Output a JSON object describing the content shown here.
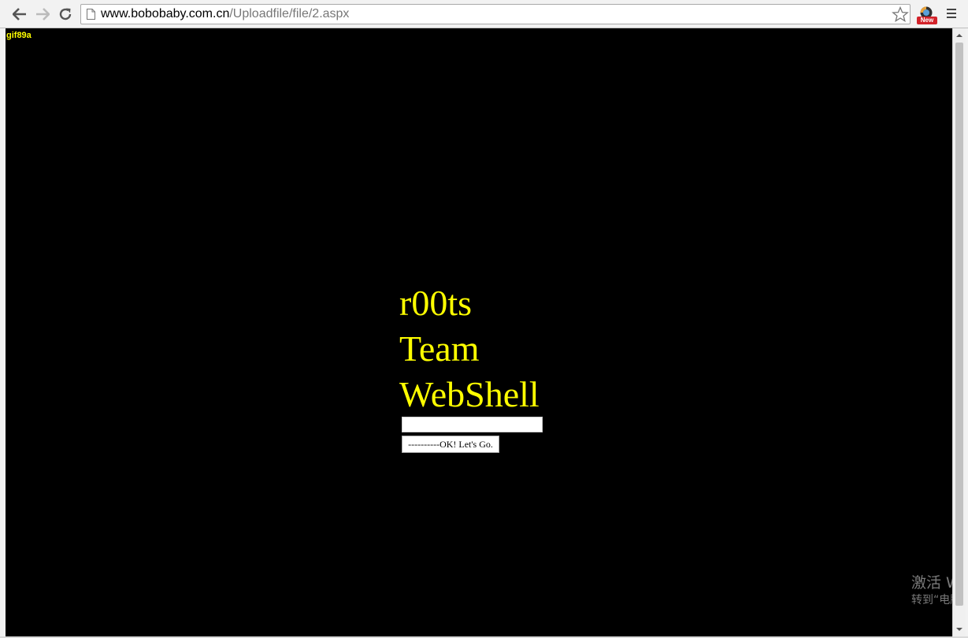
{
  "browser": {
    "url_host": "www.bobobaby.com.cn",
    "url_path": "/Uploadfile/file/2.aspx",
    "ext_badge": "New"
  },
  "page": {
    "gif_text": "gif89a",
    "title_lines": [
      "r00ts",
      "Team",
      "WebShell"
    ],
    "password_value": "",
    "submit_label": "----------OK! Let's Go."
  },
  "watermark": {
    "line1": "激活 W",
    "line2": "转到“电脑"
  },
  "colors": {
    "page_background": "#000000",
    "text_yellow": "#ffff00"
  }
}
